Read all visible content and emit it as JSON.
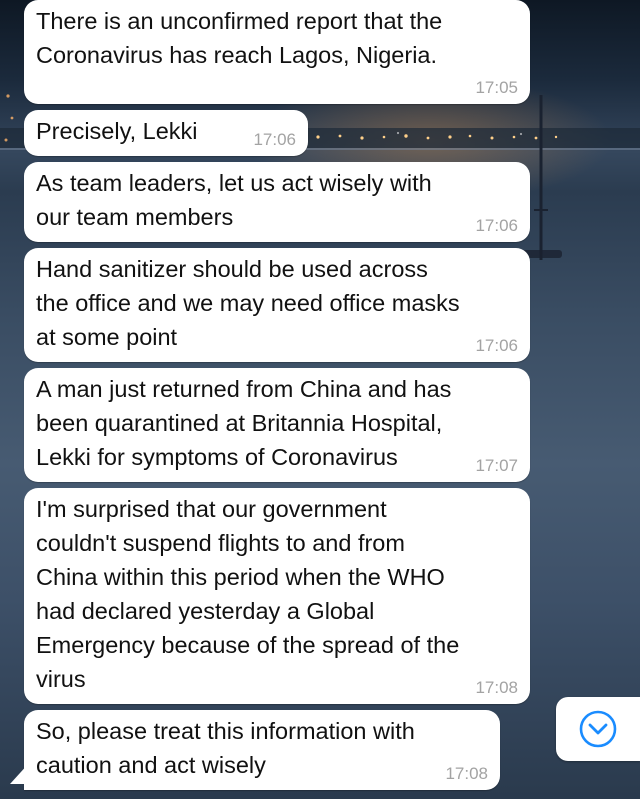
{
  "messages": [
    {
      "text": "There is an unconfirmed report that the\nCoronavirus has reach Lagos, Nigeria.",
      "time": "17:05"
    },
    {
      "text": "Precisely, Lekki",
      "time": "17:06"
    },
    {
      "text": "As team leaders, let us act wisely with\nour team members",
      "time": "17:06"
    },
    {
      "text": "Hand sanitizer should be used across\nthe office and we may need office masks\nat some point",
      "time": "17:06"
    },
    {
      "text": "A man just returned from China and has\nbeen quarantined at Britannia Hospital,\nLekki for symptoms of Coronavirus",
      "time": "17:07"
    },
    {
      "text": "I'm surprised that our government\ncouldn't suspend flights to and from\nChina within this period when the WHO\nhad declared yesterday a Global\nEmergency because of the spread of the\nvirus",
      "time": "17:08"
    },
    {
      "text": "So, please treat this information with\ncaution and act wisely",
      "time": "17:08"
    }
  ],
  "controls": {
    "scroll_down_icon": "chevron-down-circle-icon",
    "accent_color": "#1a8cff"
  }
}
